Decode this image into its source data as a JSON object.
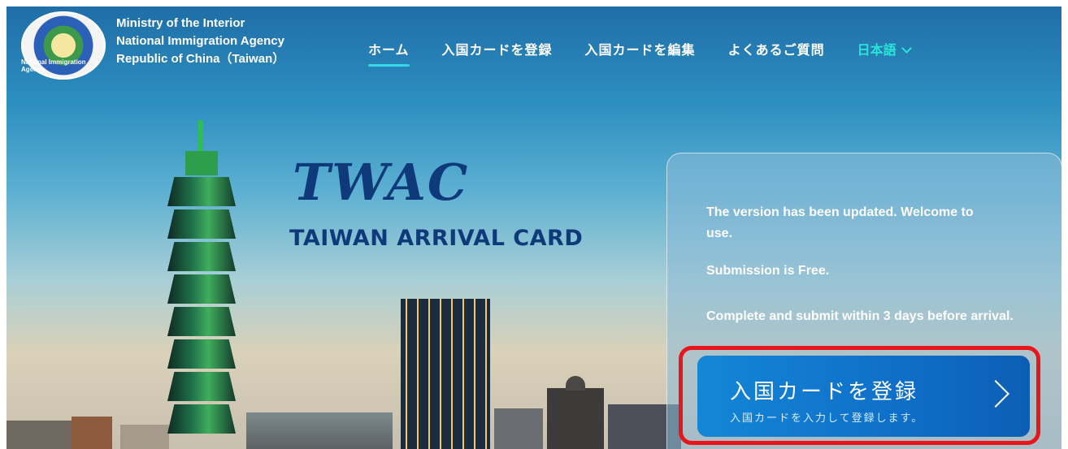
{
  "header": {
    "agency_lines": [
      "Ministry of the Interior",
      "National Immigration Agency",
      "Republic of China（Taiwan）"
    ],
    "logo_ring_text": "National Immigration Agency"
  },
  "nav": {
    "items": [
      {
        "label": "ホーム",
        "active": true
      },
      {
        "label": "入国カードを登録",
        "active": false
      },
      {
        "label": "入国カードを編集",
        "active": false
      },
      {
        "label": "よくあるご質問",
        "active": false
      }
    ],
    "language": "日本語"
  },
  "hero": {
    "logo_text": "TWAC",
    "subtitle": "TAIWAN ARRIVAL CARD"
  },
  "panel": {
    "notice": "The version has been updated. Welcome to use.",
    "free": "Submission is Free.",
    "deadline": "Complete and submit within 3 days before arrival."
  },
  "cta": {
    "title": "入国カードを登録",
    "subtitle": "入国カードを入力して登録します。"
  },
  "colors": {
    "accent": "#2be5d9",
    "brand_blue": "#0f3a7a",
    "cta_blue": "#1486d6",
    "highlight_red": "#e8151b"
  }
}
